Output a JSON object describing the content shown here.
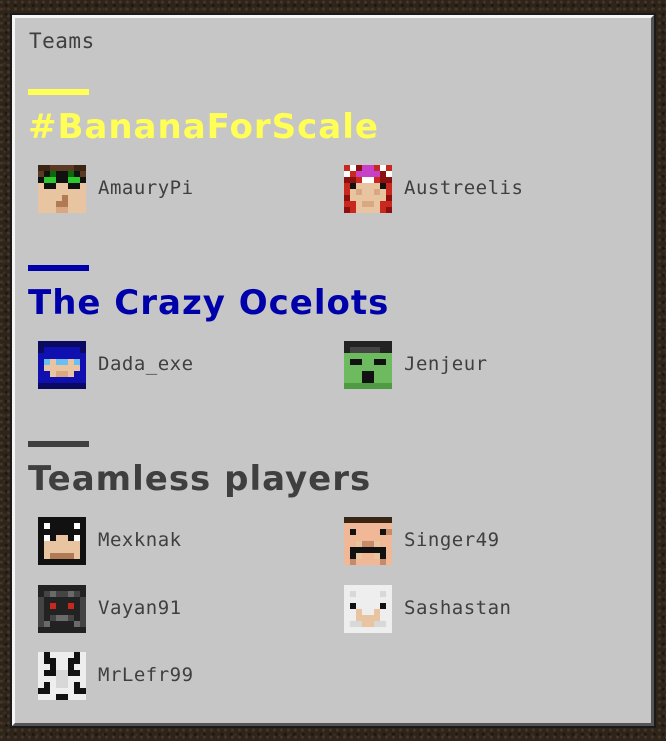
{
  "window": {
    "title": "Teams"
  },
  "teams": [
    {
      "name": "#BananaForScale",
      "color": "#ffff55",
      "players": [
        {
          "name": "AmauryPi",
          "avatar": "player-head-green-goggles"
        },
        {
          "name": "Austreelis",
          "avatar": "player-head-red-hair"
        }
      ]
    },
    {
      "name": "The Crazy Ocelots",
      "color": "#0000aa",
      "players": [
        {
          "name": "Dada_exe",
          "avatar": "player-head-blue-hood"
        },
        {
          "name": "Jenjeur",
          "avatar": "player-head-green-zombie"
        }
      ]
    },
    {
      "name": "Teamless players",
      "color": "#3f3f3f",
      "players": [
        {
          "name": "Mexknak",
          "avatar": "player-head-dark-hair"
        },
        {
          "name": "Singer49",
          "avatar": "player-head-mustache"
        },
        {
          "name": "Vayan91",
          "avatar": "player-head-dark-red-eyes"
        },
        {
          "name": "Sashastan",
          "avatar": "player-head-white-hair"
        },
        {
          "name": "MrLefr99",
          "avatar": "player-head-black-white"
        }
      ]
    }
  ]
}
